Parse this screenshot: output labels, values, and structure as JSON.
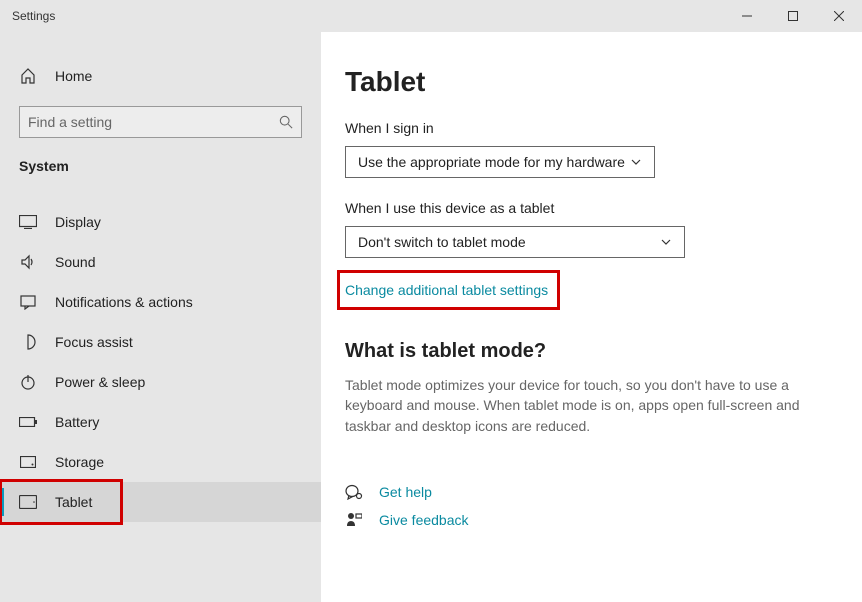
{
  "window": {
    "title": "Settings"
  },
  "sidebar": {
    "home_label": "Home",
    "search_placeholder": "Find a setting",
    "category": "System",
    "items": [
      {
        "label": "Display"
      },
      {
        "label": "Sound"
      },
      {
        "label": "Notifications & actions"
      },
      {
        "label": "Focus assist"
      },
      {
        "label": "Power & sleep"
      },
      {
        "label": "Battery"
      },
      {
        "label": "Storage"
      },
      {
        "label": "Tablet"
      }
    ]
  },
  "content": {
    "title": "Tablet",
    "signin_label": "When I sign in",
    "signin_value": "Use the appropriate mode for my hardware",
    "device_label": "When I use this device as a tablet",
    "device_value": "Don't switch to tablet mode",
    "change_settings": "Change additional tablet settings",
    "section_heading": "What is tablet mode?",
    "section_text": "Tablet mode optimizes your device for touch, so you don't have to use a keyboard and mouse. When tablet mode is on, apps open full-screen and taskbar and desktop icons are reduced.",
    "get_help": "Get help",
    "give_feedback": "Give feedback"
  }
}
